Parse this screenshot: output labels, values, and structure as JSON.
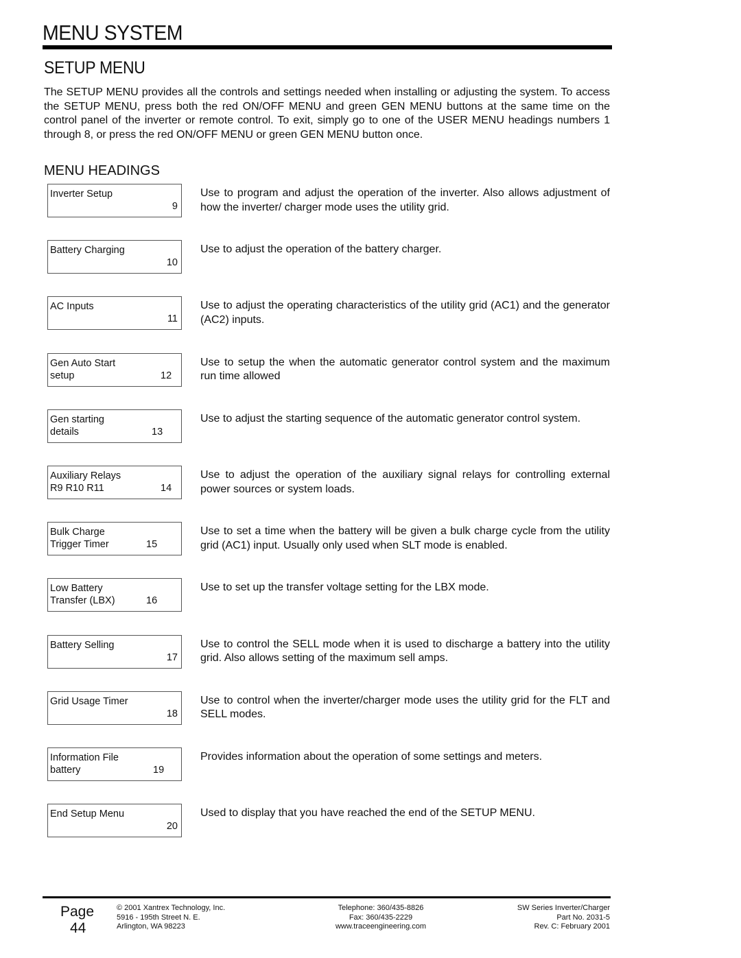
{
  "header": {
    "title": "MENU SYSTEM",
    "section_title": "SETUP MENU",
    "intro": "The SETUP MENU provides all the controls and settings needed when installing or adjusting the system. To access the SETUP MENU, press both the red ON/OFF MENU and green GEN MENU buttons at the same time on the control panel of the inverter or remote control. To exit, simply go to one of the USER MENU headings numbers 1 through 8, or press the red ON/OFF MENU or green GEN MENU button once.",
    "subsection_title": "MENU HEADINGS"
  },
  "menu_headings": [
    {
      "line1": "Inverter Setup",
      "line2": "",
      "number": "9",
      "description": "Use to program and adjust the operation of the inverter. Also allows adjustment of how the inverter/ charger mode uses the utility grid."
    },
    {
      "line1": "Battery Charging",
      "line2": "",
      "number": "10",
      "description": "Use to adjust the operation of the battery charger."
    },
    {
      "line1": "AC Inputs",
      "line2": "",
      "number": "11",
      "description": "Use to adjust the operating characteristics of the utility grid (AC1) and the generator (AC2) inputs."
    },
    {
      "line1": "Gen Auto Start",
      "line2": "setup",
      "number": "12",
      "description": "Use to setup the when the automatic generator control system and the maximum run time allowed"
    },
    {
      "line1": "Gen starting",
      "line2": "details",
      "number": "13",
      "description": "Use to adjust the starting sequence of the automatic generator control system."
    },
    {
      "line1": "Auxiliary Relays",
      "line2": "R9 R10 R11",
      "number": "14",
      "description": "Use to adjust the operation of the auxiliary signal relays for controlling external power sources or system loads."
    },
    {
      "line1": "Bulk Charge",
      "line2": "Trigger Timer",
      "number": "15",
      "description": "Use to set a time when the battery will be given a bulk charge cycle from the utility grid (AC1) input. Usually only used when SLT mode is enabled."
    },
    {
      "line1": "Low Battery",
      "line2": "Transfer (LBX)",
      "number": "16",
      "description": "Use to set up the transfer voltage setting for the LBX mode."
    },
    {
      "line1": "Battery Selling",
      "line2": "",
      "number": "17",
      "description": "Use to control the SELL mode when it is used to discharge a battery into the utility grid. Also allows setting of the maximum sell amps."
    },
    {
      "line1": "Grid Usage Timer",
      "line2": "",
      "number": "18",
      "description": "Use to control when the inverter/charger mode uses the utility grid for the FLT and SELL modes."
    },
    {
      "line1": "Information File",
      "line2": "battery",
      "number": "19",
      "description": "Provides information about the operation of some settings and meters."
    },
    {
      "line1": "End Setup Menu",
      "line2": "",
      "number": "20",
      "description": "Used to display that you have reached the end of the SETUP MENU."
    }
  ],
  "footer": {
    "page_label": "Page",
    "page_number": "44",
    "company": {
      "copyright": "© 2001  Xantrex Technology, Inc.",
      "address1": "5916 - 195th Street N. E.",
      "address2": "Arlington, WA 98223"
    },
    "contact": {
      "telephone": "Telephone: 360/435-8826",
      "fax": "Fax: 360/435-2229",
      "website": "www.traceengineering.com"
    },
    "document": {
      "product": "SW Series Inverter/Charger",
      "part_no": "Part No. 2031-5",
      "revision": "Rev. C:  February 2001"
    }
  }
}
